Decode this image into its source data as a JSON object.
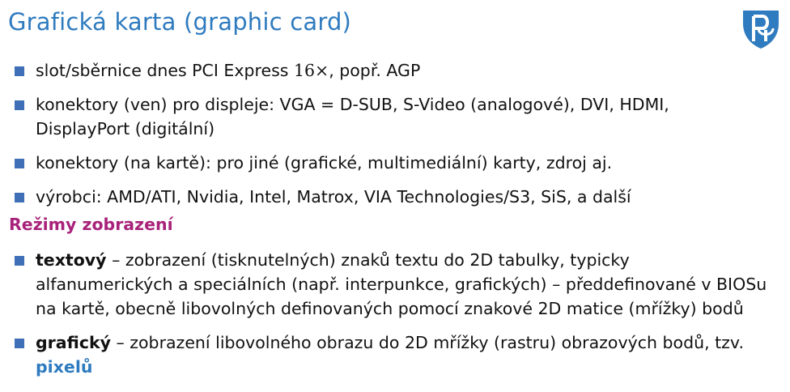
{
  "slide": {
    "title": "Grafická karta (graphic card)",
    "logo": {
      "icon": "university-logo-icon",
      "color": "#2f7bbf"
    },
    "bullets": [
      {
        "pre": "slot/sběrnice dnes PCI Express ",
        "math": "16×",
        "post": ", popř. AGP"
      },
      {
        "line1": "konektory (ven) pro displeje: VGA = D-SUB, S-Video (analogové), DVI, HDMI,",
        "line2": "DisplayPort (digitální)"
      },
      {
        "text": "konektory (na kartě): pro jiné (grafické, multimediální) karty, zdroj aj."
      },
      {
        "text": "výrobci: AMD/ATI, Nvidia, Intel, Matrox, VIA Technologies/S3, SiS, a další"
      }
    ],
    "section_heading": "Režimy zobrazení",
    "modes": [
      {
        "term": "textový",
        "line1": " – zobrazení (tisknutelných) znaků textu do 2D tabulky, typicky",
        "line2": "alfanumerických a speciálních (např. interpunkce, grafických) – předdefinované v BIOSu",
        "line3": "na kartě, obecně libovolných definovaných pomocí znakové 2D matice (mřížky) bodů"
      },
      {
        "term": "grafický",
        "line1": " – zobrazení libovolného obrazu do 2D mřížky (rastru) obrazových bodů, tzv.",
        "highlight": "pixelů"
      }
    ],
    "colors": {
      "title": "#2f7bbf",
      "bullet": "#3f6fb6",
      "section": "#a8227a",
      "highlight": "#2f7bbf"
    }
  }
}
